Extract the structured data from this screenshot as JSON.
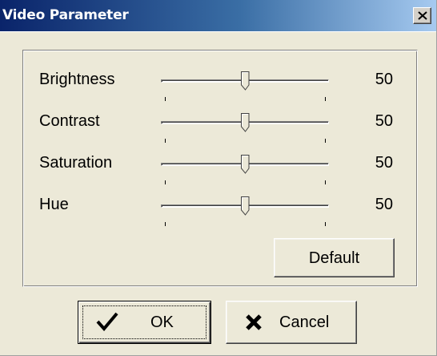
{
  "window": {
    "title": "Video Parameter",
    "close_label": "close"
  },
  "colors": {
    "title_start": "#0a246a",
    "title_end": "#a6caf0",
    "face": "#ece9d8"
  },
  "sliders": [
    {
      "label": "Brightness",
      "value": "50",
      "level": 50,
      "min": 0,
      "max": 100
    },
    {
      "label": "Contrast",
      "value": "50",
      "level": 50,
      "min": 0,
      "max": 100
    },
    {
      "label": "Saturation",
      "value": "50",
      "level": 50,
      "min": 0,
      "max": 100
    },
    {
      "label": "Hue",
      "value": "50",
      "level": 50,
      "min": 0,
      "max": 100
    }
  ],
  "buttons": {
    "default_label": "Default",
    "ok_label": "OK",
    "cancel_label": "Cancel"
  },
  "icons": {
    "ok": "checkmark-icon",
    "cancel": "x-icon",
    "close": "close-icon"
  }
}
